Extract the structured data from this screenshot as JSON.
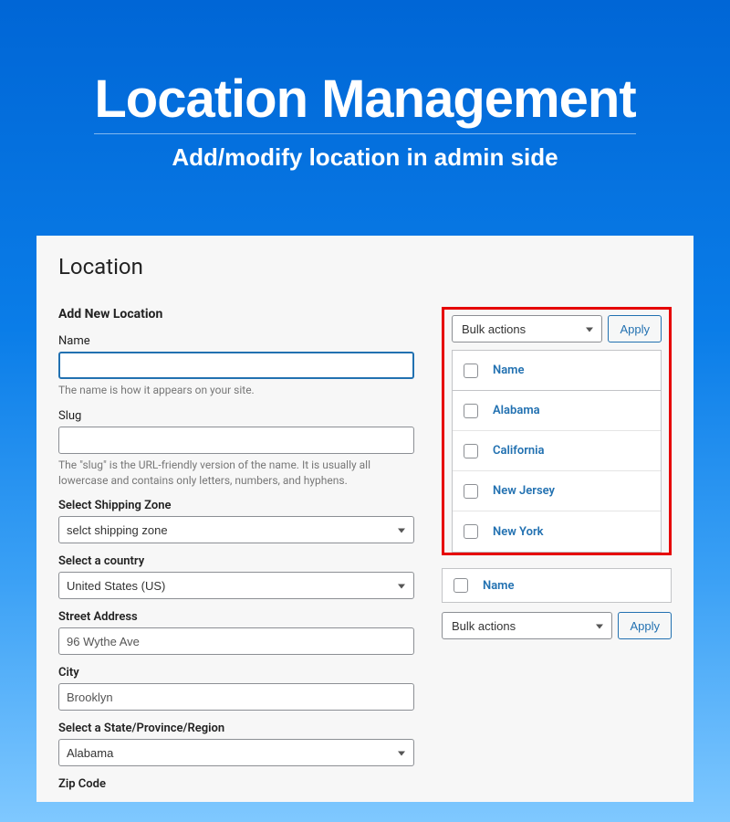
{
  "hero": {
    "title": "Location Management",
    "subtitle": "Add/modify location in admin side"
  },
  "panel": {
    "title": "Location",
    "form_heading": "Add New Location"
  },
  "form": {
    "name": {
      "label": "Name",
      "value": "",
      "help": "The name is how it appears on your site."
    },
    "slug": {
      "label": "Slug",
      "value": "",
      "help": "The \"slug\" is the URL-friendly version of the name. It is usually all lowercase and contains only letters, numbers, and hyphens."
    },
    "shipping": {
      "label": "Select Shipping Zone",
      "value": "selct shipping zone"
    },
    "country": {
      "label": "Select a country",
      "value": "United States (US)"
    },
    "street": {
      "label": "Street Address",
      "value": "96 Wythe Ave"
    },
    "city": {
      "label": "City",
      "value": "Brooklyn"
    },
    "state": {
      "label": "Select a State/Province/Region",
      "value": "Alabama"
    },
    "zip": {
      "label": "Zip Code"
    }
  },
  "bulk": {
    "label": "Bulk actions",
    "apply": "Apply"
  },
  "table": {
    "header": "Name",
    "rows": [
      "Alabama",
      "California",
      "New Jersey",
      "New York"
    ]
  }
}
